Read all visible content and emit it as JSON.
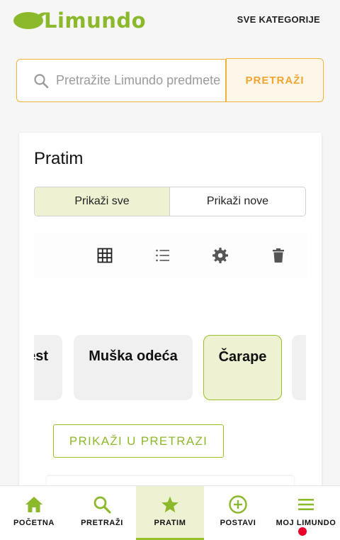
{
  "header": {
    "logo_text": "Limundo",
    "all_categories_label": "SVE KATEGORIJE"
  },
  "search": {
    "placeholder": "Pretražite Limundo predmete",
    "button_label": "PRETRAŽI"
  },
  "following": {
    "title": "Pratim",
    "toggle": {
      "show_all_label": "Prikaži sve",
      "show_new_label": "Prikaži nove",
      "selected": "Prikaži sve"
    },
    "toolbar_icons": [
      "grid-view-icon",
      "list-view-icon",
      "settings-icon",
      "delete-icon"
    ],
    "categories": [
      {
        "label": "est",
        "selected": false
      },
      {
        "label": "Muška odeća",
        "selected": false
      },
      {
        "label": "Čarape",
        "selected": true
      },
      {
        "label": "",
        "selected": false
      }
    ],
    "show_in_search_label": "PRIKAŽI U PRETRAZI"
  },
  "bottom_nav": {
    "items": [
      {
        "label": "POČETNA",
        "icon": "home-icon",
        "active": false
      },
      {
        "label": "PRETRAŽI",
        "icon": "search-icon",
        "active": false
      },
      {
        "label": "PRATIM",
        "icon": "star-icon",
        "active": true
      },
      {
        "label": "POSTAVI",
        "icon": "add-circle-icon",
        "active": false
      },
      {
        "label": "MOJ LIMUNDO",
        "icon": "menu-icon",
        "active": false,
        "has_notification": true
      }
    ]
  },
  "colors": {
    "brand_green": "#8cb82c",
    "accent_orange": "#f2a530",
    "active_bg": "#eef2d2",
    "notification_red": "#e8002a"
  }
}
